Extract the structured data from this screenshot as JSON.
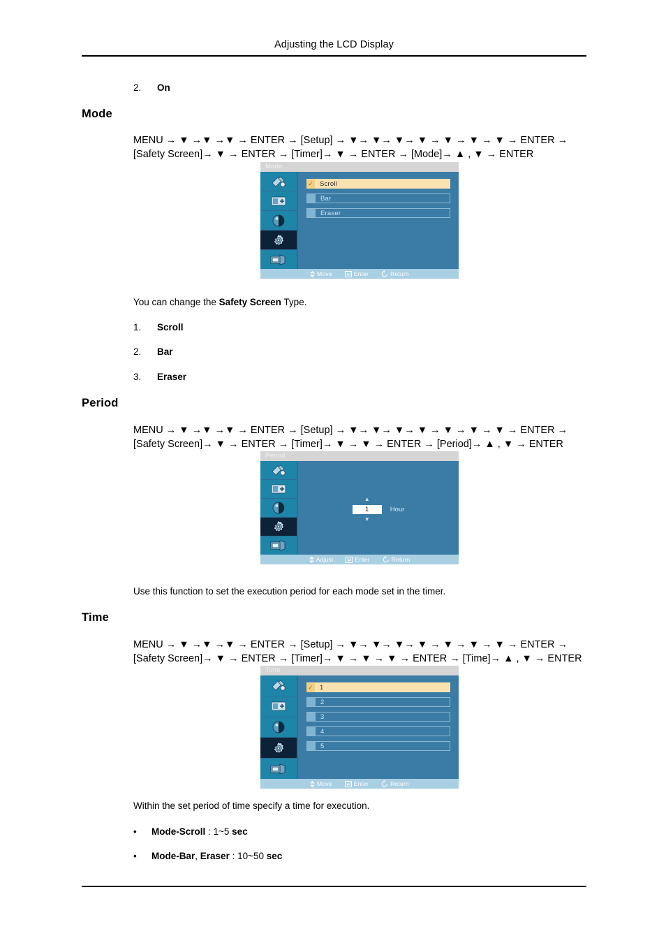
{
  "header": {
    "title": "Adjusting the LCD Display"
  },
  "top_item": {
    "number": "2.",
    "label": "On"
  },
  "sections": {
    "mode": {
      "heading": "Mode",
      "path_line1": "MENU → ▼ →▼ →▼ → ENTER → [Setup] → ▼→ ▼→ ▼→ ▼ → ▼ → ▼ → ▼ → ENTER →",
      "path_line2": "[Safety Screen]→ ▼ → ENTER → [Timer]→ ▼ → ENTER → [Mode]→ ▲ , ▼ → ENTER",
      "description_pre": "You can change the ",
      "description_bold": "Safety Screen",
      "description_post": " Type.",
      "options": [
        {
          "number": "1.",
          "label": "Scroll"
        },
        {
          "number": "2.",
          "label": "Bar"
        },
        {
          "number": "3.",
          "label": "Eraser"
        }
      ]
    },
    "period": {
      "heading": "Period",
      "path_line1": "MENU → ▼ →▼ →▼ → ENTER → [Setup] → ▼→ ▼→ ▼→ ▼ → ▼ → ▼ → ▼ → ENTER →",
      "path_line2": "[Safety Screen]→ ▼ → ENTER → [Timer]→ ▼ → ▼ → ENTER → [Period]→ ▲ , ▼ → ENTER",
      "description": "Use this function to set the execution period for each mode set in the timer."
    },
    "time": {
      "heading": "Time",
      "path_line1": "MENU → ▼ →▼ →▼ → ENTER → [Setup] → ▼→ ▼→ ▼→ ▼ → ▼ → ▼ → ▼ → ENTER →",
      "path_line2": "[Safety Screen]→ ▼ → ENTER → [Timer]→ ▼ → ▼ → ▼ → ENTER → [Time]→ ▲ , ▼ → ENTER",
      "description": "Within the set period of time specify a time for execution.",
      "bullets": [
        {
          "dot": "•",
          "bold1": "Mode-Scroll",
          "mid": " : 1~5 ",
          "bold2": "sec"
        },
        {
          "dot": "•",
          "bold1": "Mode-Bar",
          "mid": ", ",
          "bold1b": "Eraser",
          "mid2": " : 10~50 ",
          "bold2": "sec"
        }
      ]
    }
  },
  "osd": {
    "icons": [
      "picture-brush-icon",
      "screen-adjust-icon",
      "contrast-circle-icon",
      "gear-setup-icon",
      "multi-display-icon"
    ],
    "selected_icon_index": 3,
    "mode_panel": {
      "title": "Mode",
      "rows": [
        {
          "label": "Scroll",
          "selected": true,
          "check": "✓"
        },
        {
          "label": "Bar",
          "selected": false,
          "check": ""
        },
        {
          "label": "Eraser",
          "selected": false,
          "check": ""
        }
      ],
      "footer": [
        {
          "icon": "updown-arrows-icon",
          "label": "Move"
        },
        {
          "icon": "enter-key-icon",
          "label": "Enter"
        },
        {
          "icon": "return-arrow-icon",
          "label": "Return"
        }
      ]
    },
    "period_panel": {
      "title": "Period",
      "up_arrow": "▲",
      "value": "1",
      "down_arrow": "▼",
      "unit": "Hour",
      "footer": [
        {
          "icon": "updown-arrows-icon",
          "label": "Adjust"
        },
        {
          "icon": "enter-key-icon",
          "label": "Enter"
        },
        {
          "icon": "return-arrow-icon",
          "label": "Return"
        }
      ]
    },
    "time_panel": {
      "title": "Time",
      "rows": [
        {
          "label": "1",
          "selected": true,
          "check": "✓"
        },
        {
          "label": "2",
          "selected": false,
          "check": ""
        },
        {
          "label": "3",
          "selected": false,
          "check": ""
        },
        {
          "label": "4",
          "selected": false,
          "check": ""
        },
        {
          "label": "5",
          "selected": false,
          "check": ""
        }
      ],
      "footer": [
        {
          "icon": "updown-arrows-icon",
          "label": "Move"
        },
        {
          "icon": "enter-key-icon",
          "label": "Enter"
        },
        {
          "icon": "return-arrow-icon",
          "label": "Return"
        }
      ]
    }
  },
  "colors": {
    "osd_background": "#3b7ca6",
    "osd_sidebar": "#1e84a8",
    "osd_selected_icon": "#0d2137",
    "osd_highlight_row": "#fae2b0",
    "osd_footer": "#a9cfe2",
    "osd_titlebar": "#d5d5d5"
  }
}
